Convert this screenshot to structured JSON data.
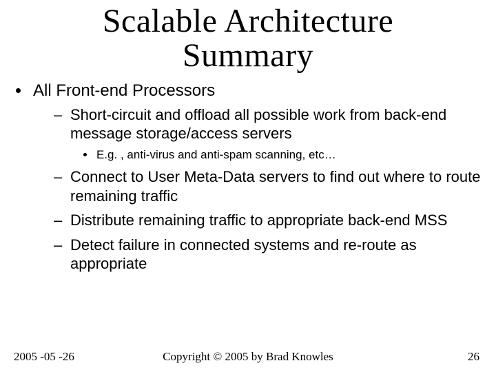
{
  "title_line1": "Scalable Architecture",
  "title_line2": "Summary",
  "bullets": {
    "l1_0": "All Front-end Processors",
    "l2_0": "Short-circuit and offload all possible work from back-end message storage/access servers",
    "l3_0": "E.g. , anti-virus and anti-spam scanning, etc…",
    "l2_1": "Connect to User Meta-Data servers to find out where to route remaining traffic",
    "l2_2": "Distribute remaining traffic to appropriate back-end MSS",
    "l2_3": "Detect failure in connected systems and re-route as appropriate"
  },
  "footer": {
    "date": "2005 -05 -26",
    "copyright": "Copyright © 2005 by Brad Knowles",
    "page": "26"
  }
}
